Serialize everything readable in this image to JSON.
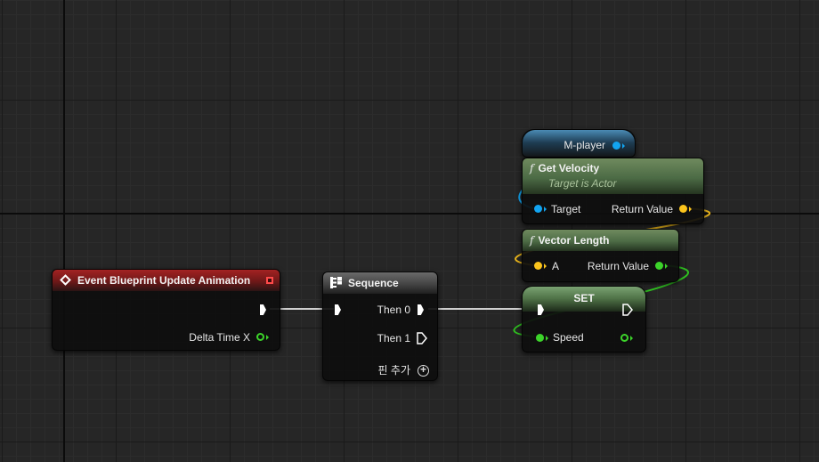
{
  "nodes": {
    "event": {
      "title": "Event Blueprint Update Animation",
      "pin_delta": "Delta Time X"
    },
    "sequence": {
      "title": "Sequence",
      "pin_then0": "Then 0",
      "pin_then1": "Then 1",
      "add_pin": "핀 추가"
    },
    "var_get": {
      "title": "M-player"
    },
    "get_velocity": {
      "glyph": "f",
      "title": "Get Velocity",
      "subtitle": "Target is Actor",
      "pin_target": "Target",
      "pin_return": "Return Value"
    },
    "vector_length": {
      "glyph": "f",
      "title": "Vector Length",
      "pin_a": "A",
      "pin_return": "Return Value"
    },
    "set": {
      "title": "SET",
      "pin_speed": "Speed"
    }
  },
  "colors": {
    "exec": "#ffffff",
    "object_pin": "#12a4f0",
    "vector_pin": "#fbc41c",
    "float_pin": "#3cd42a",
    "event_header": "#a32222",
    "function_header": "#5c7e55",
    "canvas": "#262626"
  },
  "icons": {
    "event": "event-diamond-icon",
    "sequence": "sequence-icon",
    "function": "function-icon",
    "add_pin": "add-circle-icon"
  }
}
